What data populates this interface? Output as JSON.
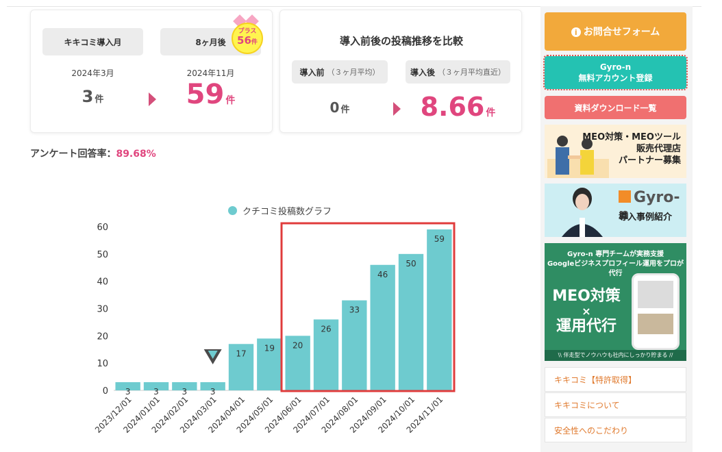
{
  "card_left": {
    "label_month": "キキコミ導入月",
    "label_after": "8ヶ月後",
    "badge_top": "プラス",
    "badge_value": "56",
    "badge_unit": "件",
    "date_start": "2024年3月",
    "date_end": "2024年11月",
    "count_start": "3",
    "count_end": "59",
    "unit": "件"
  },
  "card_right": {
    "title": "導入前後の投稿推移を比較",
    "before_label": "導入前",
    "before_sub": "（３ヶ月平均）",
    "after_label": "導入後",
    "after_sub": "（３ヶ月平均直近）",
    "before_value": "0",
    "after_value": "8.66",
    "unit": "件"
  },
  "survey": {
    "label": "アンケート回答率：",
    "value": "89.68%"
  },
  "chart_data": {
    "type": "bar",
    "legend": "クチコミ投稿数グラフ",
    "categories": [
      "2023/12/01",
      "2024/01/01",
      "2024/02/01",
      "2024/03/01",
      "2024/04/01",
      "2024/05/01",
      "2024/06/01",
      "2024/07/01",
      "2024/08/01",
      "2024/09/01",
      "2024/10/01",
      "2024/11/01"
    ],
    "series": [
      {
        "name": "クチコミ投稿数グラフ",
        "values": [
          3,
          3,
          3,
          3,
          17,
          19,
          20,
          26,
          33,
          46,
          50,
          59
        ]
      }
    ],
    "ylim": [
      0,
      60
    ],
    "yticks": [
      0,
      10,
      20,
      30,
      40,
      50,
      60
    ],
    "highlight_range": [
      "2024/06/01",
      "2024/11/01"
    ],
    "marker_at": "2024/03/01",
    "bar_color": "#6ecbcf",
    "highlight_color": "#e03c3c"
  },
  "sidebar": {
    "contact": "お問合せフォーム",
    "signup_line1": "Gyro-n",
    "signup_line2": "無料アカウント登録",
    "download": "資料ダウンロード一覧",
    "banner1_lines": [
      "MEO対策・MEOツール",
      "販売代理店",
      "パートナー募集"
    ],
    "banner2_logo": "Gyro-n",
    "banner2_text": "導入事例紹介",
    "banner3_top1": "Gyro-n 専門チームが実務支援",
    "banner3_top2": "Googleビジネスプロフィール運用をプロが代行",
    "banner3_big1": "MEO対策",
    "banner3_big2": "×",
    "banner3_big3": "運用代行",
    "banner3_foot": "\\\\ 伴走型でノウハウも社内にしっかり貯まる //",
    "menu": [
      "キキコミ【特許取得】",
      "キキコミについて",
      "安全性へのこだわり"
    ]
  }
}
